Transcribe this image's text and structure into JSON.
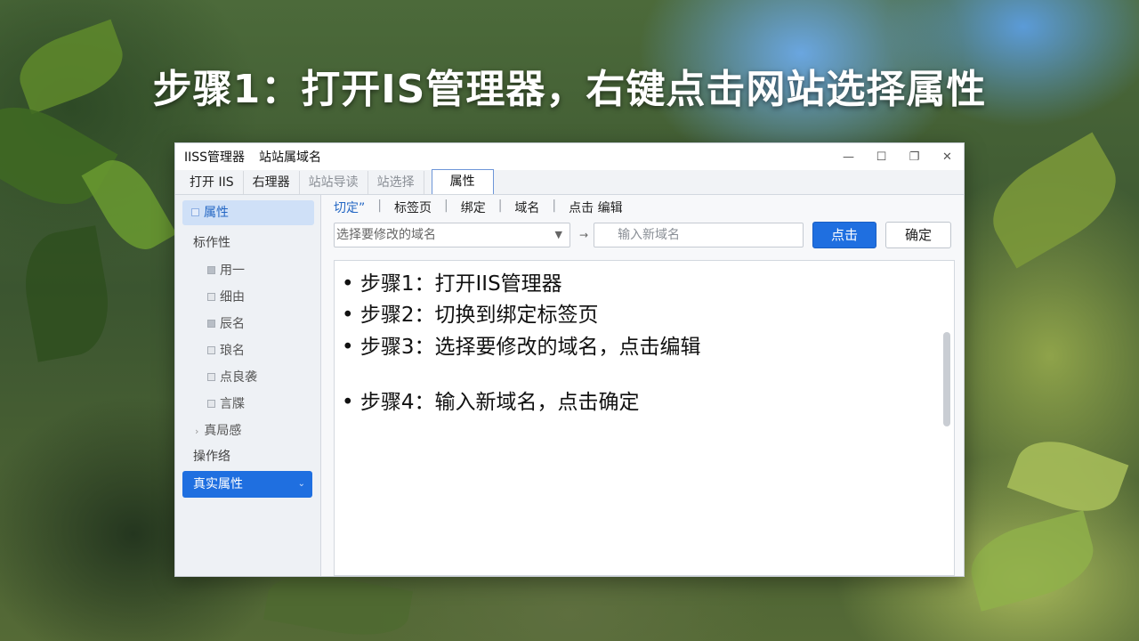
{
  "slide": {
    "title": "步骤1：打开IS管理器，右键点击网站选择属性"
  },
  "window": {
    "title_parts": [
      "IISS管理器",
      "站站属域名"
    ],
    "controls": {
      "minimize": "—",
      "maximize": "☐",
      "restore": "❐",
      "close": "✕"
    },
    "tabs": [
      {
        "label": "打开 IIS",
        "state": "normal"
      },
      {
        "label": "右理器",
        "state": "normal"
      },
      {
        "label": "站站导读",
        "state": "dim"
      },
      {
        "label": "站选择",
        "state": "dim"
      },
      {
        "label": "属性",
        "state": "active"
      }
    ]
  },
  "sidebar": {
    "selected": "属性",
    "section": "标作性",
    "items": [
      {
        "label": "用一",
        "filled": true
      },
      {
        "label": "细由",
        "filled": false
      },
      {
        "label": "辰名",
        "filled": true
      },
      {
        "label": "琅名",
        "filled": false
      },
      {
        "label": "点良袭",
        "filled": false
      },
      {
        "label": "言牒",
        "filled": false
      }
    ],
    "expander": "真局感",
    "expander_mark": "›",
    "footer_label": "操作络",
    "bottom_button": "真实属性",
    "bottom_chevron": "⌄"
  },
  "main": {
    "subtabs": [
      "切定”",
      "标签页",
      "绑定",
      "域名",
      "点击 编辑"
    ],
    "select": {
      "value": "选择要修改的域名",
      "arrow": "▼"
    },
    "arrow": "→",
    "input": {
      "placeholder": "输入新域名"
    },
    "click_button": "点击",
    "ok_button": "确定",
    "steps": [
      "• 步骤1：打开IIS管理器",
      "• 步骤2：切换到绑定标签页",
      "• 步骤3：选择要修改的域名，点击编辑",
      "• 步骤4：输入新域名，点击确定"
    ]
  },
  "colors": {
    "accent": "#1f6fe0",
    "selected_bg": "#cfe0f7",
    "link": "#2467c4"
  }
}
